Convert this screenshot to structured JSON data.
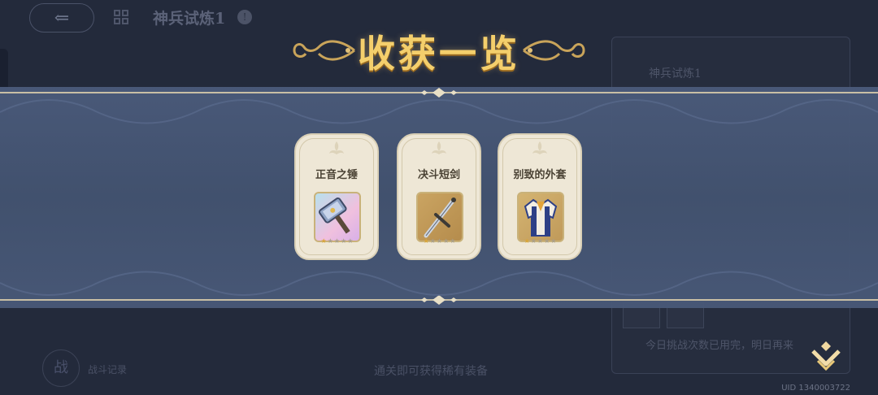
{
  "background": {
    "back_arrow": "⇐",
    "stage_title": "神兵试炼1",
    "info_badge": "!",
    "panel_title": "神兵试炼1",
    "panel_note": "今日挑战次数已用完，明日再来",
    "emblem_glyph": "战",
    "emblem_label": "战斗记录",
    "bottom_hint": "通关即可获得稀有装备"
  },
  "header": {
    "title": "收获一览"
  },
  "rewards": [
    {
      "name": "正音之锤",
      "icon": "hammer-icon",
      "stars": 1,
      "max_stars": 5,
      "frame_color": "#e8b9d8"
    },
    {
      "name": "决斗短剑",
      "icon": "sword-icon",
      "stars": 1,
      "max_stars": 5,
      "frame_color": "#d9b56a"
    },
    {
      "name": "别致的外套",
      "icon": "coat-icon",
      "stars": 1,
      "max_stars": 5,
      "frame_color": "#d9b56a"
    }
  ],
  "uid": "UID 1340003722",
  "colors": {
    "gold": "#f4cf6c",
    "banner": "#46567a",
    "card": "#eee7d6"
  }
}
